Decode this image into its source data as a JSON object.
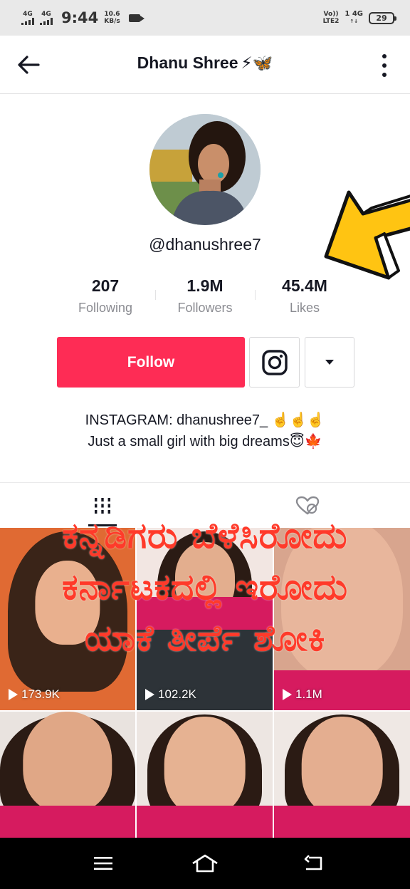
{
  "status_bar": {
    "sim1": "4G",
    "sim2": "4G",
    "time": "9:44",
    "speed_value": "10.6",
    "speed_unit": "KB/s",
    "volte_top": "Vo))",
    "volte_bottom": "LTE2",
    "network_top": "1 4G",
    "network_bottom": "↑↓",
    "battery": "29"
  },
  "header": {
    "title": "Dhanu Shree",
    "title_emoji": "⚡🦋"
  },
  "profile": {
    "handle": "@dhanushree7",
    "stats": [
      {
        "value": "207",
        "label": "Following"
      },
      {
        "value": "1.9M",
        "label": "Followers"
      },
      {
        "value": "45.4M",
        "label": "Likes"
      }
    ],
    "follow_label": "Follow",
    "bio_line1": "INSTAGRAM: dhanushree7_ ☝️☝️☝️",
    "bio_line2": "Just a small girl with big dreams😇🍁"
  },
  "videos": [
    {
      "views": "173.9K"
    },
    {
      "views": "102.2K"
    },
    {
      "views": "1.1M"
    },
    {
      "views": ""
    },
    {
      "views": ""
    },
    {
      "views": ""
    }
  ],
  "overlay_text": [
    "ಕನ್ನಡಿಗರು ಬೆಳೆಸಿರೋದು",
    "ಕರ್ನಾಟಕದಲ್ಲಿ ಇರೋದು",
    "ಯಾಕೆ ತೀರ್ಪೆ ಶೋಕಿ"
  ],
  "colors": {
    "follow_button": "#fe2c55",
    "arrow": "#ffc412",
    "overlay_text": "#ff3a2a"
  }
}
